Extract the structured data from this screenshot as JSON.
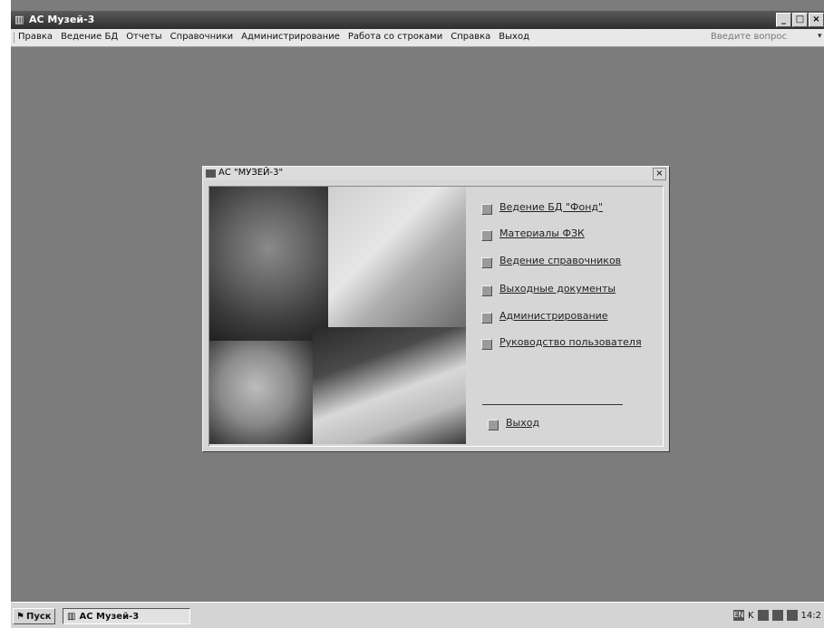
{
  "window": {
    "title": "AC Музей-3",
    "buttons": {
      "minimize": "_",
      "maximize": "□",
      "close": "×"
    }
  },
  "menubar": {
    "items": [
      "Правка",
      "Ведение БД",
      "Отчеты",
      "Справочники",
      "Администрирование",
      "Работа со строками",
      "Справка",
      "Выход"
    ],
    "question_placeholder": "Введите вопрос",
    "question_arrow": "▾"
  },
  "dialog": {
    "title": "АС \"МУЗЕЙ-3\"",
    "close": "×",
    "nav_items": [
      "Ведение БД \"Фонд\"",
      "Материалы ФЗК",
      "Ведение справочников",
      "Выходные документы",
      "Администрирование",
      "Руководство пользователя"
    ],
    "exit_label": "Выход"
  },
  "taskbar": {
    "start_label": "Пуск",
    "task_label": "AC Музей-3",
    "time": "14:2",
    "tray_lang": "EN",
    "tray_k": "K"
  },
  "icons": {
    "window": "museum-icon",
    "start": "windows-flag-icon",
    "task": "museum-icon",
    "tray": [
      "language-icon",
      "keyboard-icon",
      "monitor-icon",
      "speaker-icon",
      "network-icon"
    ]
  }
}
